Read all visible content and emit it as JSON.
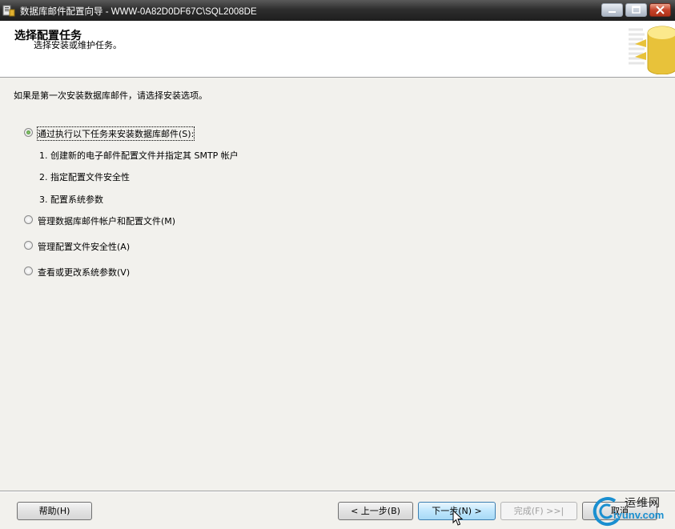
{
  "window": {
    "title": "数据库邮件配置向导 - WWW-0A82D0DF67C\\SQL2008DE",
    "controls": [
      "minimize-icon",
      "maximize-icon",
      "close-icon"
    ]
  },
  "header": {
    "title": "选择配置任务",
    "subtitle": "选择安装或维护任务。",
    "logo_icon": "database-icon"
  },
  "main": {
    "intro": "如果是第一次安装数据库邮件，请选择安装选项。",
    "options": [
      {
        "label": "通过执行以下任务来安装数据库邮件(S):",
        "selected": true
      },
      {
        "label": "管理数据库邮件帐户和配置文件(M)",
        "selected": false
      },
      {
        "label": "管理配置文件安全性(A)",
        "selected": false
      },
      {
        "label": "查看或更改系统参数(V)",
        "selected": false
      }
    ],
    "steps": [
      "1. 创建新的电子邮件配置文件并指定其 SMTP 帐户",
      "2. 指定配置文件安全性",
      "3. 配置系统参数"
    ]
  },
  "footer": {
    "help": "帮助(H)",
    "back": "< 上一步(B)",
    "next": "下一步(N) >",
    "finish": "完成(F) >>|",
    "cancel": "取消"
  },
  "watermark": {
    "line1": "运维网",
    "line2": "iyunv.com"
  }
}
